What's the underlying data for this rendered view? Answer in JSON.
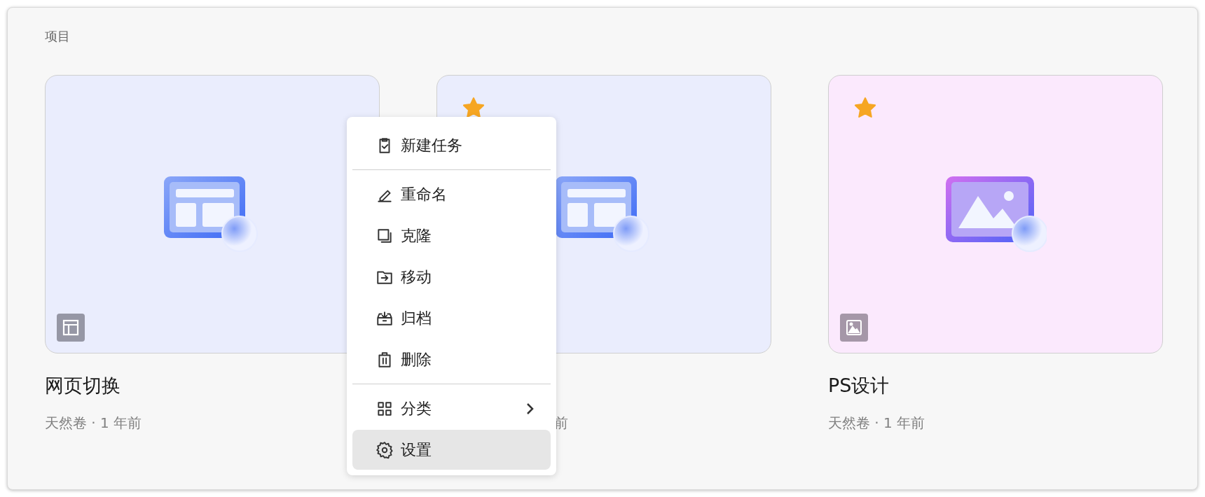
{
  "section_title": "项目",
  "projects": [
    {
      "kind": "web",
      "title": "网页切换",
      "meta": "天然卷 · 1 年前",
      "starred": false,
      "color": "#eaedfd"
    },
    {
      "kind": "web",
      "meta": "前",
      "starred": true,
      "color": "#eaedfd"
    },
    {
      "kind": "image",
      "title": "PS设计",
      "meta": "天然卷 · 1 年前",
      "starred": true,
      "color": "#fbe9fd"
    }
  ],
  "menu": [
    {
      "kind": "item",
      "label": "新建任务",
      "selected": false,
      "submenu": false
    },
    {
      "kind": "divider"
    },
    {
      "kind": "item",
      "label": "重命名",
      "selected": false,
      "submenu": false
    },
    {
      "kind": "item",
      "label": "克隆",
      "selected": false,
      "submenu": false
    },
    {
      "kind": "item",
      "label": "移动",
      "selected": false,
      "submenu": false
    },
    {
      "kind": "item",
      "label": "归档",
      "selected": false,
      "submenu": false
    },
    {
      "kind": "item",
      "label": "删除",
      "selected": false,
      "submenu": false
    },
    {
      "kind": "divider"
    },
    {
      "kind": "item",
      "label": "分类",
      "selected": false,
      "submenu": true
    },
    {
      "kind": "item",
      "label": "设置",
      "selected": true,
      "submenu": false
    }
  ]
}
